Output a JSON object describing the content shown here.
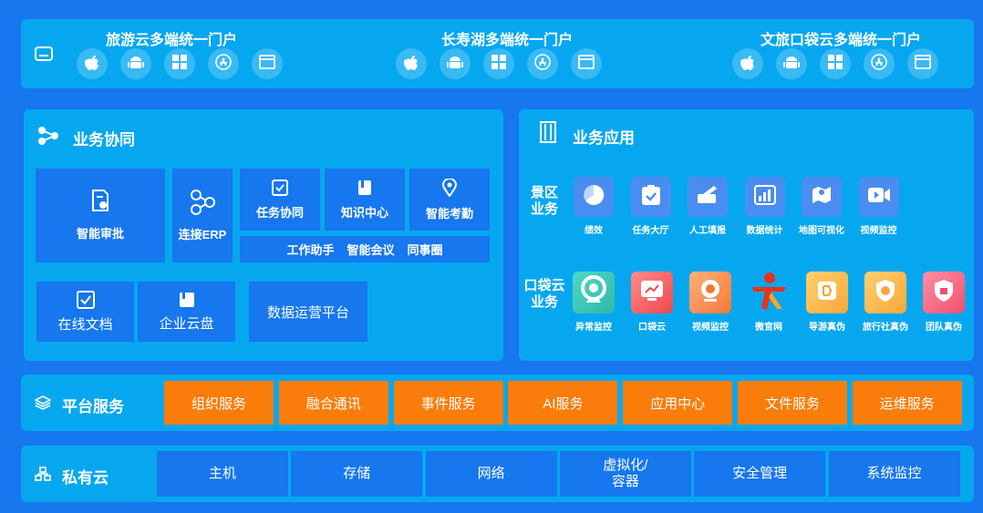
{
  "portals": [
    {
      "title": "旅游云多端统一门户"
    },
    {
      "title": "长寿湖多端统一门户"
    },
    {
      "title": "文旅口袋云多端统一门户"
    }
  ],
  "collab": {
    "title": "业务协同",
    "approval": "智能审批",
    "erp": "连接ERP",
    "task": "任务协同",
    "knowledge": "知识中心",
    "attendance": "智能考勤",
    "assistant": "工作助手",
    "meeting": "智能会议",
    "circle": "同事圈",
    "docs": "在线文档",
    "disk": "企业云盘",
    "ops": "数据运营平台"
  },
  "apps": {
    "title": "业务应用",
    "scenic_label": "景区\n业务",
    "pocket_label": "口袋云\n业务",
    "scenic": [
      "绩效",
      "任务大厅",
      "人工填报",
      "数据统计",
      "地图可视化",
      "视频监控"
    ],
    "pocket": [
      "异常监控",
      "口袋云",
      "视频监控",
      "微官网",
      "导游真伪",
      "旅行社真伪",
      "团队真伪"
    ]
  },
  "platform": {
    "title": "平台服务",
    "services": [
      "组织服务",
      "融合通讯",
      "事件服务",
      "AI服务",
      "应用中心",
      "文件服务",
      "运维服务"
    ]
  },
  "cloud": {
    "title": "私有云",
    "items": [
      "主机",
      "存储",
      "网络",
      "虚拟化/\n容器",
      "安全管理",
      "系统监控"
    ]
  },
  "colors": {
    "background": "#1677ee",
    "panel": "#07a7f0",
    "tile": "#1677ee",
    "service": "#fa7c0a"
  }
}
